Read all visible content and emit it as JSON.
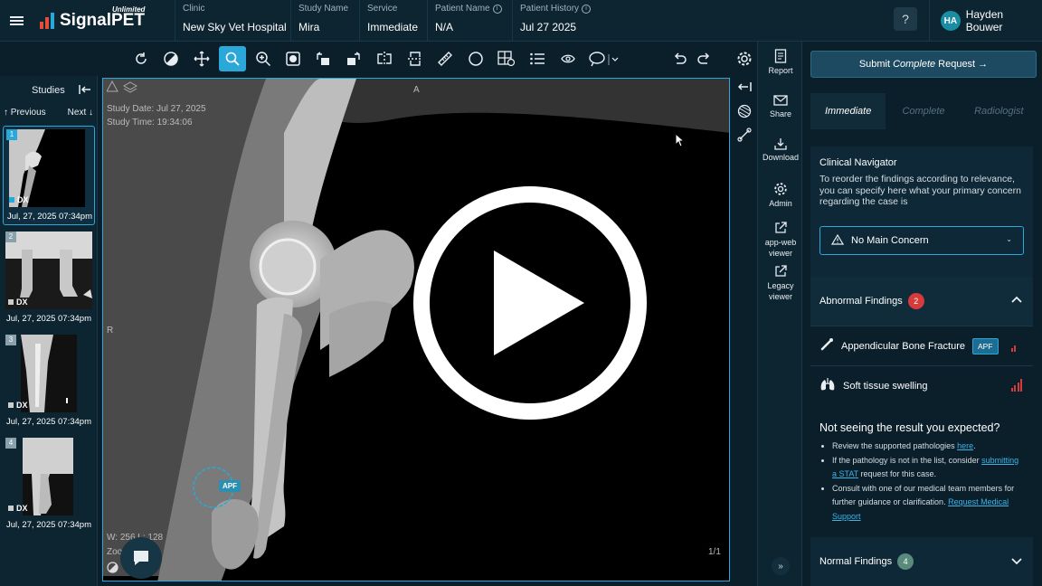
{
  "app": {
    "brand": "SignalPET",
    "brand_sub": "Unlimited"
  },
  "header": {
    "fields": [
      {
        "label": "Clinic",
        "value": "New Sky Vet Hospital",
        "info": false
      },
      {
        "label": "Study Name",
        "value": "Mira",
        "info": false
      },
      {
        "label": "Service",
        "value": "Immediate",
        "info": false
      },
      {
        "label": "Patient Name",
        "value": "N/A",
        "info": true
      },
      {
        "label": "Patient History",
        "value": "Jul 27 2025",
        "info": true
      }
    ],
    "help": "?",
    "user": {
      "initials": "HA",
      "name": "Hayden Bouwer"
    }
  },
  "toolbar": {
    "tools": [
      "rotate-icon",
      "contrast-icon",
      "pan-icon",
      "zoom-icon",
      "magnify-icon",
      "invert-icon",
      "rotate-left-icon",
      "rotate-right-icon",
      "flip-horizontal-icon",
      "flip-vertical-icon",
      "ruler-icon",
      "ellipse-icon",
      "grid-settings-icon",
      "list-icon",
      "eye-icon",
      "annotation-icon",
      "undo-icon",
      "redo-icon",
      "settings-icon"
    ],
    "active": "zoom-icon"
  },
  "studies": {
    "title": "Studies",
    "prev": "↑ Previous",
    "next": "Next ↓",
    "items": [
      {
        "num": "1",
        "modality": "DX",
        "date": "Jul, 27, 2025 07:34pm",
        "selected": true
      },
      {
        "num": "2",
        "modality": "DX",
        "date": "Jul, 27, 2025 07:34pm",
        "selected": false
      },
      {
        "num": "3",
        "modality": "DX",
        "date": "Jul, 27, 2025 07:34pm",
        "selected": false
      },
      {
        "num": "4",
        "modality": "DX",
        "date": "Jul, 27, 2025 07:34pm",
        "selected": false
      }
    ]
  },
  "viewer": {
    "study_date": "Study Date: Jul 27, 2025",
    "study_time": "Study Time: 19:34:06",
    "orient_top": "A",
    "orient_left": "R",
    "wl": "W: 256 L: 128",
    "zoom": "Zoo",
    "frame": "1/1",
    "apf_tag": "APF"
  },
  "actions": [
    {
      "label": "Report",
      "icon": "report-icon"
    },
    {
      "label": "Share",
      "icon": "share-icon"
    },
    {
      "label": "Download",
      "icon": "download-icon"
    },
    {
      "label": "Admin",
      "icon": "admin-icon"
    },
    {
      "label": "app-web viewer",
      "icon": "external-link-icon"
    },
    {
      "label": "Legacy viewer",
      "icon": "external-link-icon"
    }
  ],
  "panel": {
    "submit": {
      "pre": "Submit",
      "em": "Complete",
      "post": "Request →"
    },
    "tabs": [
      "Immediate",
      "Complete",
      "Radiologist"
    ],
    "clinical": {
      "title": "Clinical Navigator",
      "desc": "To reorder the findings according to relevance, you can specify here what your primary concern regarding the case is",
      "concern": "No Main Concern"
    },
    "abnormal": {
      "title": "Abnormal Findings",
      "count": "2",
      "items": [
        {
          "label": "Appendicular Bone Fracture",
          "badge": "APF",
          "level": 1
        },
        {
          "label": "Soft tissue swelling",
          "badge": "",
          "level": 4
        }
      ]
    },
    "not_seeing": {
      "title": "Not seeing the result you expected?",
      "b1_pre": "Review the supported pathologies ",
      "b1_link": "here",
      "b1_post": ".",
      "b2_pre": "If the pathology is not in the list, consider ",
      "b2_link": "submitting a STAT",
      "b2_post": " request for this case.",
      "b3_pre": "Consult with one of our medical team members for further guidance or clarification. ",
      "b3_link": "Request Medical Support"
    },
    "normal": {
      "title": "Normal Findings",
      "count": "4"
    }
  },
  "colors": {
    "accent": "#2aa8d9",
    "alert": "#d73a3a",
    "bg": "#0b1f2b"
  }
}
